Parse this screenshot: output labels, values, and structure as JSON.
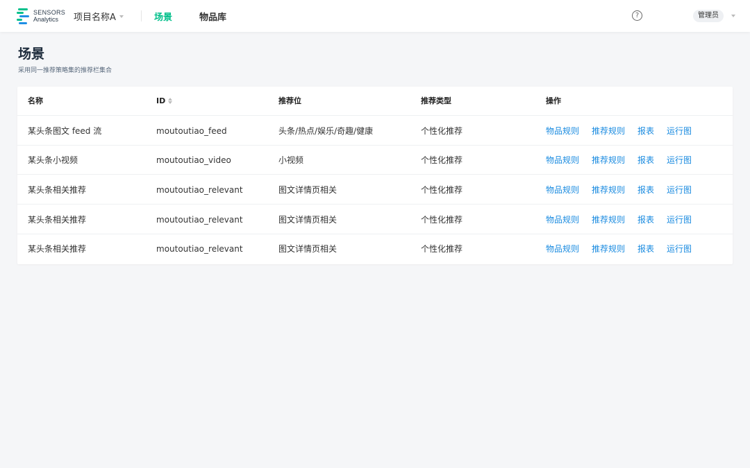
{
  "header": {
    "logo": {
      "line1": "SENSORS",
      "line2": "Analytics"
    },
    "project_name": "项目名称A",
    "nav": [
      {
        "label": "场景",
        "active": true
      },
      {
        "label": "物品库",
        "active": false
      }
    ],
    "help_symbol": "?",
    "user_label": "管理员"
  },
  "page": {
    "title": "场景",
    "description": "采用同一推荐策略集的推荐栏集合"
  },
  "table": {
    "columns": [
      "名称",
      "ID",
      "推荐位",
      "推荐类型",
      "操作"
    ],
    "rows": [
      {
        "name": "某头条图文 feed 流",
        "id": "moutoutiao_feed",
        "slot": "头条/热点/娱乐/奇趣/健康",
        "type": "个性化推荐"
      },
      {
        "name": "某头条小视频",
        "id": "moutoutiao_video",
        "slot": "小视频",
        "type": "个性化推荐"
      },
      {
        "name": "某头条相关推荐",
        "id": "moutoutiao_relevant",
        "slot": "图文详情页相关",
        "type": "个性化推荐"
      },
      {
        "name": "某头条相关推荐",
        "id": "moutoutiao_relevant",
        "slot": "图文详情页相关",
        "type": "个性化推荐"
      },
      {
        "name": "某头条相关推荐",
        "id": "moutoutiao_relevant",
        "slot": "图文详情页相关",
        "type": "个性化推荐"
      }
    ],
    "actions": [
      "物品规则",
      "推荐规则",
      "报表",
      "运行图"
    ]
  },
  "colors": {
    "accent": "#00bf8a",
    "link": "#1a8be0",
    "background": "#f5f6f8"
  }
}
